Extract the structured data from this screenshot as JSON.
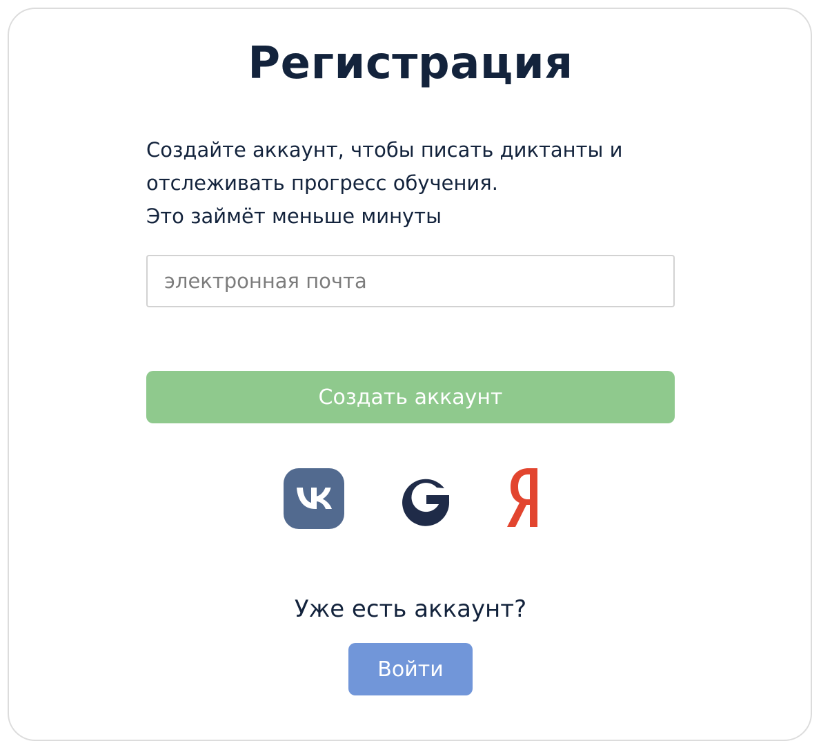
{
  "page": {
    "title": "Регистрация",
    "description_lines": [
      "Создайте аккаунт, чтобы писать диктанты и",
      "отслеживать прогресс обучения.",
      "Это займёт меньше минуты"
    ]
  },
  "form": {
    "email_placeholder": "электронная почта",
    "email_value": "",
    "create_button_label": "Создать аккаунт"
  },
  "social": {
    "providers": [
      {
        "icon": "vk-icon",
        "color": "#526a8f"
      },
      {
        "icon": "google-icon",
        "color": "#1f2b48"
      },
      {
        "icon": "yandex-icon",
        "color": "#e2452f",
        "glyph": "Я"
      }
    ]
  },
  "login": {
    "prompt": "Уже есть аккаунт?",
    "button_label": "Войти"
  },
  "colors": {
    "text": "#13233c",
    "create_button": "#8fc98d",
    "login_button": "#7196d9",
    "border": "#dcdcdc"
  }
}
